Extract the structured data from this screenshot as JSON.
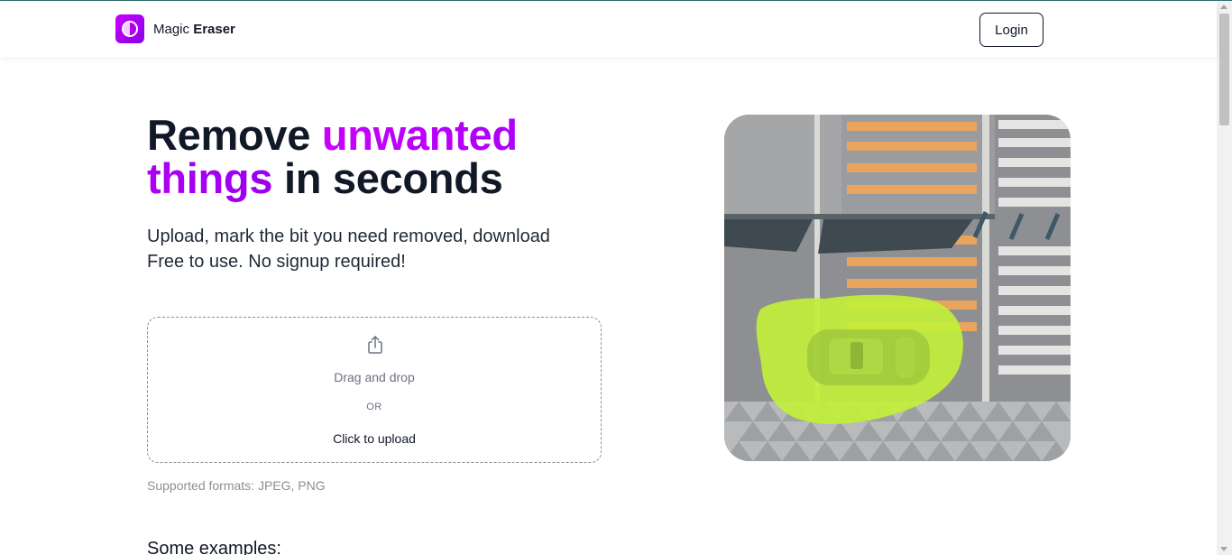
{
  "header": {
    "brand_light": "Magic",
    "brand_bold": "Eraser",
    "login_label": "Login"
  },
  "hero": {
    "title_part1": "Remove ",
    "title_accent": "unwanted things",
    "title_part2": " in seconds",
    "subtitle_line1": "Upload, mark the bit you need removed, download",
    "subtitle_line2": "Free to use. No signup required!",
    "image_icon": "aerial-car-crosswalk-image"
  },
  "upload": {
    "icon": "upload-icon",
    "drag_text": "Drag and drop",
    "or_text": "OR",
    "click_text": "Click to upload",
    "formats_text": "Supported formats: JPEG, PNG"
  },
  "examples": {
    "heading": "Some examples:"
  },
  "colors": {
    "accent_start": "#c800ff",
    "accent_end": "#9b00ee",
    "mask_highlight": "#c2f03a"
  }
}
